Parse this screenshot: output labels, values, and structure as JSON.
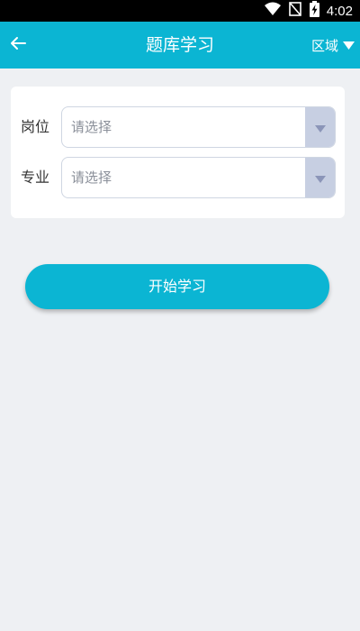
{
  "status_bar": {
    "time": "4:02",
    "icons": [
      "wifi-icon",
      "no-signal-icon",
      "battery-charging-icon"
    ]
  },
  "app_bar": {
    "back_icon": "arrow-left-icon",
    "title": "题库学习",
    "region_label": "区域",
    "region_icon": "triangle-down-icon"
  },
  "form": {
    "position": {
      "label": "岗位",
      "placeholder": "请选择"
    },
    "major": {
      "label": "专业",
      "placeholder": "请选择"
    }
  },
  "actions": {
    "start_label": "开始学习"
  },
  "colors": {
    "accent": "#0bb5d3",
    "background": "#eef0f3",
    "select_arrow_bg": "#c7cfe2",
    "select_arrow_fg": "#8b95b8"
  }
}
